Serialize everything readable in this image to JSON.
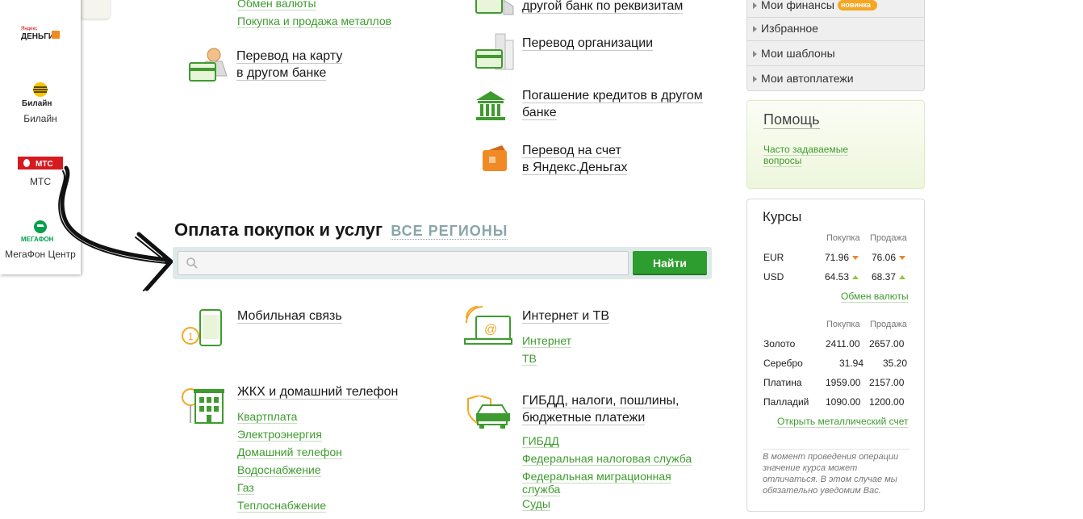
{
  "left_panel": {
    "items": [
      {
        "label": "",
        "logo": "yandex-money-logo",
        "logo_text": "Яндекс ДЕНЬГИ"
      },
      {
        "label": "Билайн",
        "logo": "beeline-logo",
        "logo_text": "Билайн"
      },
      {
        "label": "МТС",
        "logo": "mts-logo",
        "logo_text": "МТС"
      },
      {
        "label": "МегаФон Центр",
        "logo": "megafon-logo",
        "logo_text": "МЕГАФОН"
      }
    ]
  },
  "transfers": {
    "col1_links": [
      "Обмен валюты",
      "Покупка и продажа металлов"
    ],
    "card_transfer": {
      "line1": "Перевод на карту",
      "line2": "в другом банке",
      "icon": "card-person-icon"
    },
    "col2_top": "другой банк по реквизитам",
    "org_transfer": {
      "label": "Перевод организации",
      "icon": "building-card-icon"
    },
    "loan": {
      "line1": "Погашение кредитов в другом",
      "line2": "банке",
      "icon": "bank-icon"
    },
    "yandex": {
      "line1": "Перевод на счет",
      "line2": "в Яндекс.Деньгах",
      "icon": "wallet-icon"
    }
  },
  "payments": {
    "title": "Оплата покупок и услуг",
    "region": "ВСЕ РЕГИОНЫ",
    "search_placeholder": "",
    "find_button": "Найти",
    "categories": [
      {
        "title": "Мобильная связь",
        "icon": "mobile-phone-icon",
        "links": []
      },
      {
        "title": "Интернет и ТВ",
        "icon": "laptop-wifi-icon",
        "links": [
          "Интернет",
          "ТВ"
        ]
      },
      {
        "title": "ЖКХ и домашний телефон",
        "icon": "house-icon",
        "links": [
          "Квартплата",
          "Электроэнергия",
          "Домашний телефон",
          "Водоснабжение",
          "Газ",
          "Теплоснабжение"
        ]
      },
      {
        "title_line1": "ГИБДД, налоги, пошлины,",
        "title_line2": "бюджетные платежи",
        "icon": "car-shield-icon",
        "links": [
          "ГИБДД",
          "Федеральная налоговая служба",
          "Федеральная миграционная",
          "служба",
          "Суды"
        ]
      }
    ]
  },
  "right_menu": {
    "items": [
      {
        "label": "Мои финансы",
        "badge": "новинка"
      },
      {
        "label": "Избранное"
      },
      {
        "label": "Мои шаблоны"
      },
      {
        "label": "Мои автоплатежи"
      }
    ]
  },
  "help": {
    "title": "Помощь",
    "faq_line1": "Часто задаваемые",
    "faq_line2": "вопросы"
  },
  "rates": {
    "title": "Курсы",
    "buy": "Покупка",
    "sell": "Продажа",
    "currencies": [
      {
        "name": "EUR",
        "buy": "71.96",
        "sell": "76.06",
        "trend": "down"
      },
      {
        "name": "USD",
        "buy": "64.53",
        "sell": "68.37",
        "trend": "up"
      }
    ],
    "exchange_link": "Обмен валюты",
    "metals": [
      {
        "name": "Золото",
        "buy": "2411.00",
        "sell": "2657.00"
      },
      {
        "name": "Серебро",
        "buy": "31.94",
        "sell": "35.20"
      },
      {
        "name": "Платина",
        "buy": "1959.00",
        "sell": "2157.00"
      },
      {
        "name": "Палладий",
        "buy": "1090.00",
        "sell": "1200.00"
      }
    ],
    "metal_account_link": "Открыть металлический счет",
    "note": "В момент проведения операции значение курса может отличаться. В этом случае мы обязательно уведомим Вас."
  },
  "colors": {
    "green": "#3f9b2f",
    "button_green": "#2e9d2f",
    "orange": "#e8862a",
    "search_bg": "#dfe9ea"
  }
}
